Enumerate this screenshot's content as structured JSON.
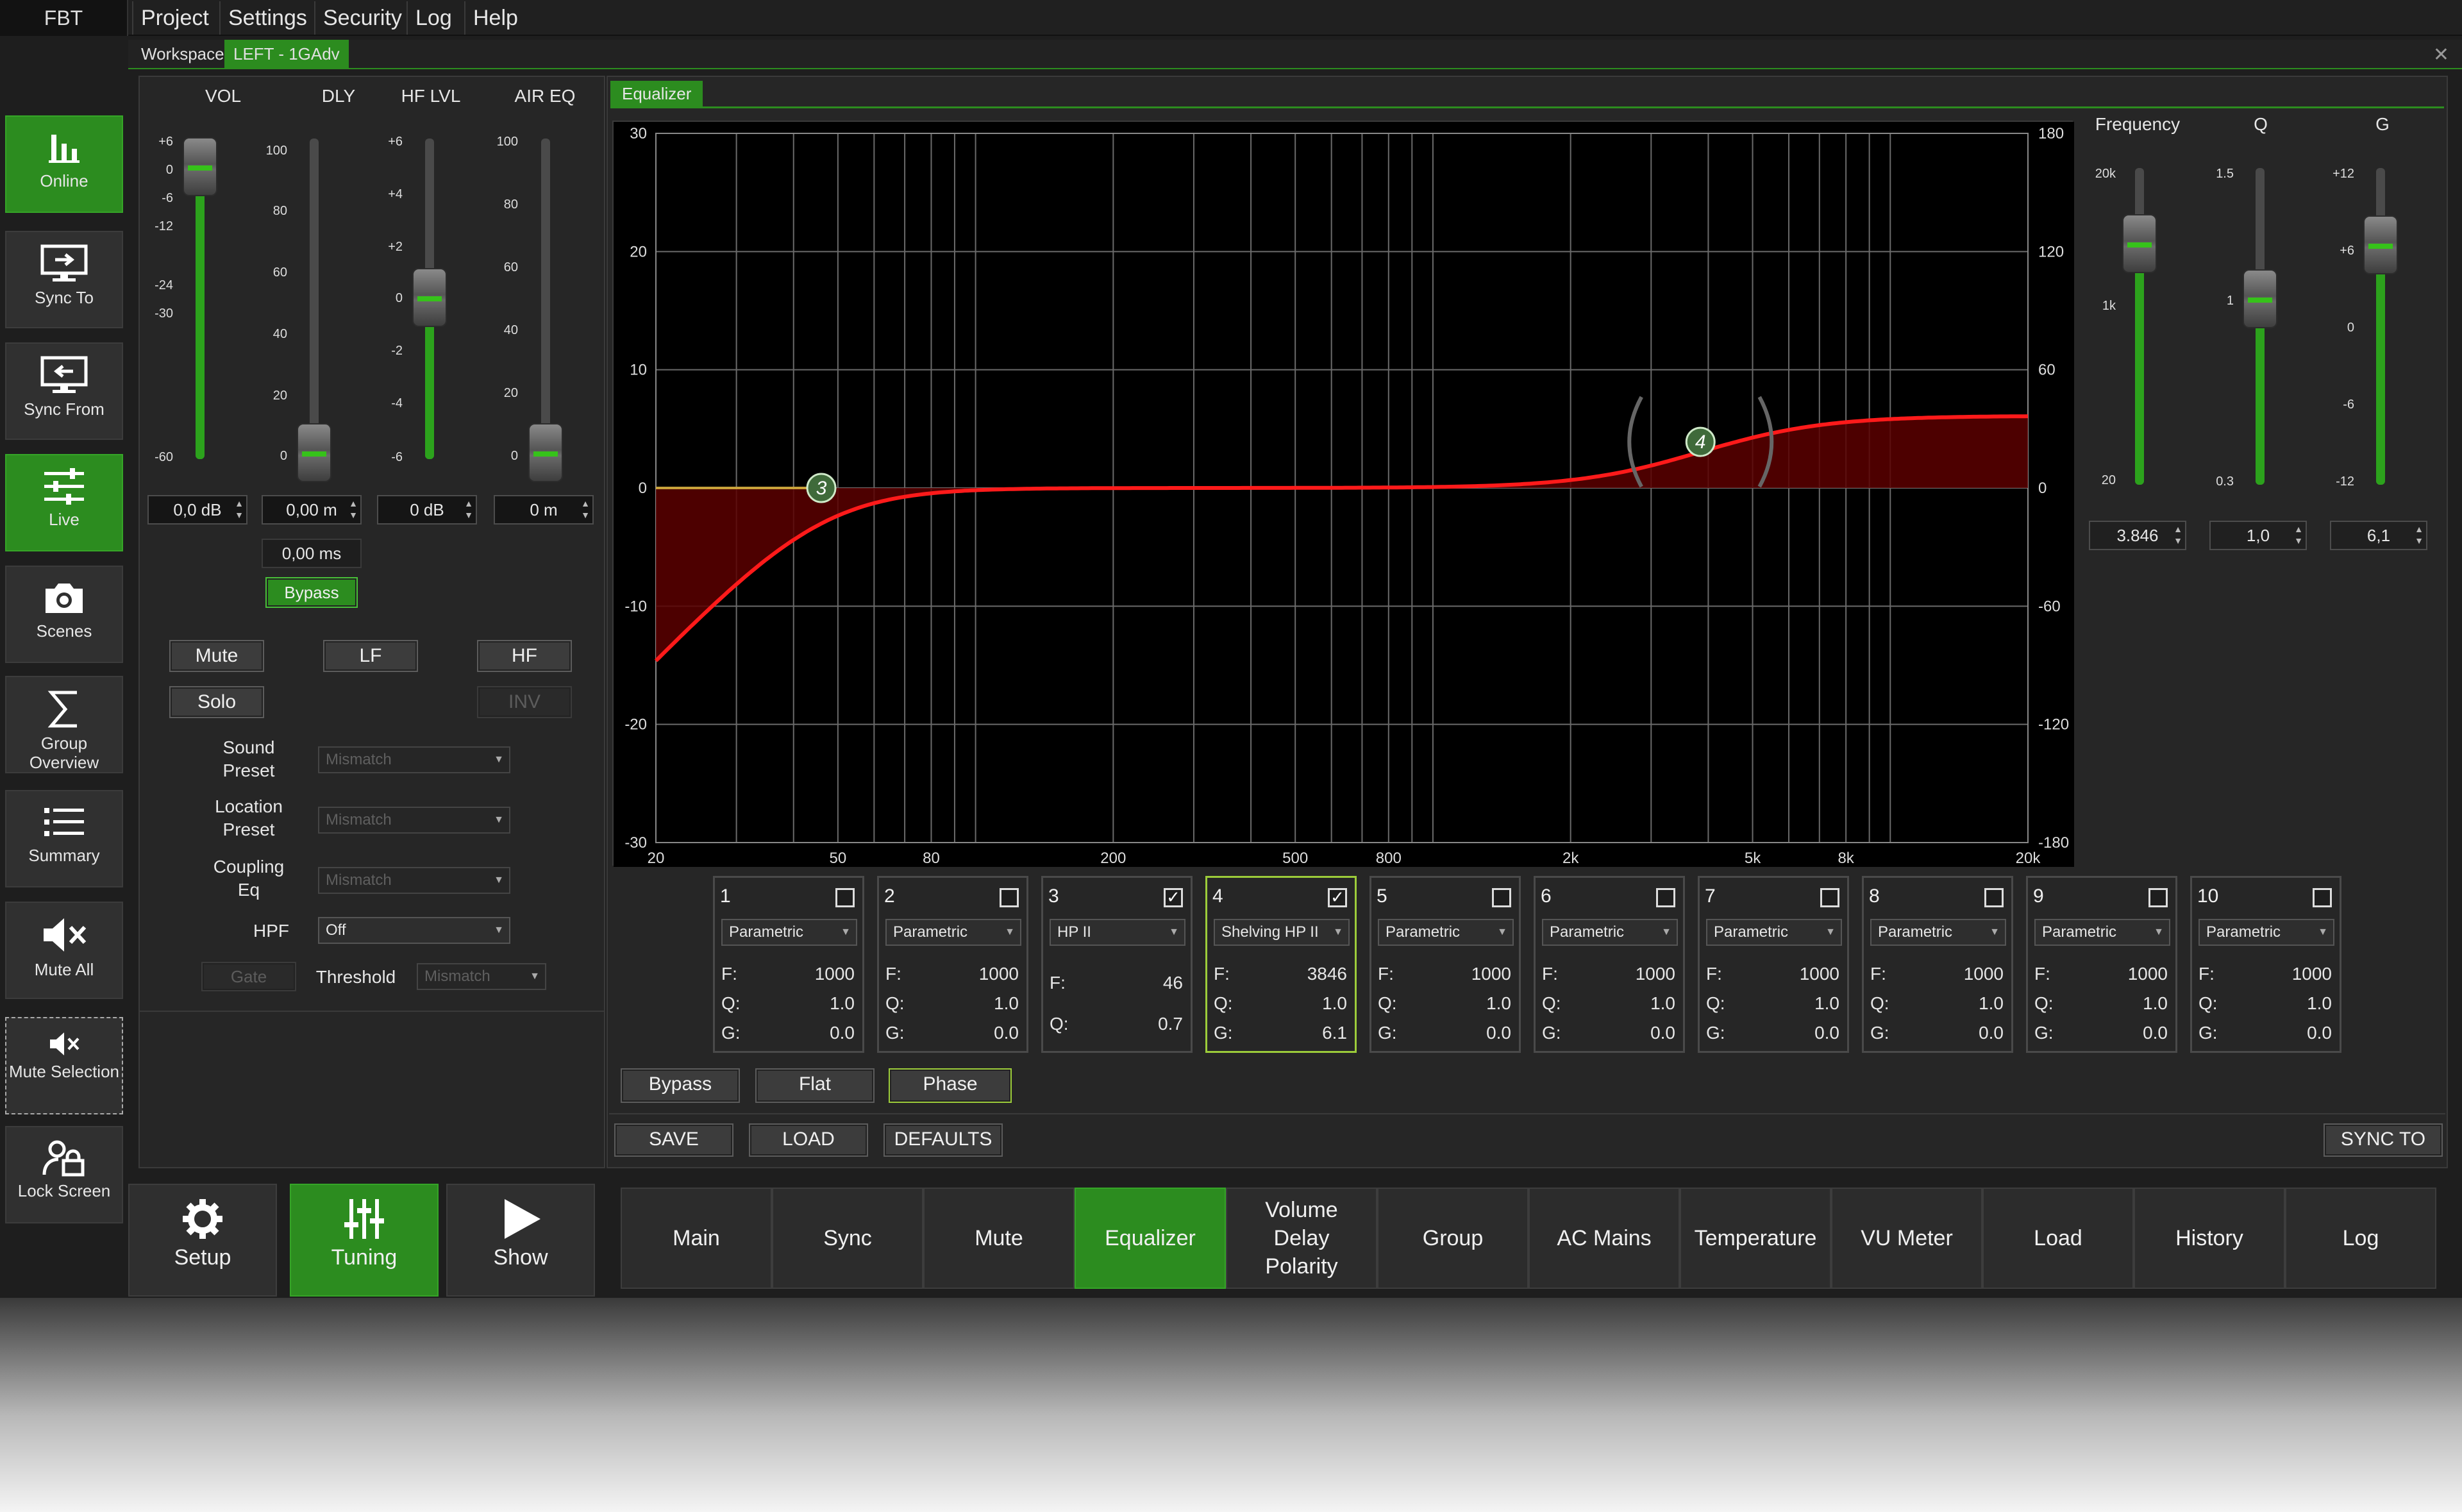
{
  "menu": {
    "brand": "FBT",
    "items": [
      "Project",
      "Settings",
      "Security",
      "Log",
      "Help"
    ]
  },
  "workspace_tabs": {
    "workspace": "Workspace",
    "device": "LEFT - 1GAdv"
  },
  "nav": [
    {
      "label": "Online",
      "icon": "bars-chart-icon",
      "active": true
    },
    {
      "label": "Sync To",
      "icon": "monitor-sync-to-icon",
      "active": false
    },
    {
      "label": "Sync From",
      "icon": "monitor-sync-from-icon",
      "active": false
    },
    {
      "label": "Live",
      "icon": "sliders-icon",
      "active": true
    },
    {
      "label": "Scenes",
      "icon": "camera-icon",
      "active": false
    },
    {
      "label": "Group Overview",
      "icon": "sigma-icon",
      "active": false
    },
    {
      "label": "Summary",
      "icon": "list-icon",
      "active": false
    },
    {
      "label": "Mute All",
      "icon": "speaker-mute-icon",
      "active": false
    },
    {
      "label": "Mute Selection",
      "icon": "speaker-mute-small-icon",
      "active": false
    },
    {
      "label": "Lock Screen",
      "icon": "user-lock-icon",
      "active": false
    }
  ],
  "channel": {
    "headers": {
      "vol": "VOL",
      "dly": "DLY",
      "hflvl": "HF LVL",
      "aireq": "AIR EQ"
    },
    "vol_ticks": [
      "+6",
      "0",
      "-6",
      "-12",
      "-24",
      "-30",
      "-60"
    ],
    "dly_ticks": [
      "100",
      "80",
      "60",
      "40",
      "20",
      "0"
    ],
    "hf_ticks": [
      "+6",
      "+4",
      "+2",
      "0",
      "-2",
      "-4",
      "-6"
    ],
    "air_ticks": [
      "100",
      "80",
      "60",
      "40",
      "20",
      "0"
    ],
    "vol_value": "0,0 dB",
    "dly_value": "0,00 m",
    "hf_value": "0 dB",
    "air_value": "0 m",
    "dly_ms": "0,00 ms",
    "bypass": "Bypass",
    "mute": "Mute",
    "lf": "LF",
    "hf": "HF",
    "solo": "Solo",
    "inv": "INV",
    "sound_preset_label": "Sound Preset",
    "sound_preset_value": "Mismatch",
    "location_preset_label": "Location Preset",
    "location_preset_value": "Mismatch",
    "coupling_eq_label": "Coupling Eq",
    "coupling_eq_value": "Mismatch",
    "hpf_label": "HPF",
    "hpf_value": "Off",
    "gate": "Gate",
    "threshold_label": "Threshold",
    "threshold_value": "Mismatch"
  },
  "eq": {
    "tab": "Equalizer",
    "y_left": [
      "30",
      "20",
      "10",
      "0",
      "-10",
      "-20",
      "-30"
    ],
    "y_right": [
      "180",
      "120",
      "60",
      "0",
      "-60",
      "-120",
      "-180"
    ],
    "x_labels": [
      "20",
      "50",
      "80",
      "200",
      "500",
      "800",
      "2k",
      "5k",
      "8k",
      "20k"
    ],
    "markers": [
      "3",
      "4"
    ],
    "right_panel": {
      "frequency": "Frequency",
      "q": "Q",
      "g": "G",
      "f_ticks": [
        "20k",
        "1k",
        "20"
      ],
      "q_ticks": [
        "1.5",
        "1",
        "0.3"
      ],
      "g_ticks": [
        "+12",
        "+6",
        "0",
        "-6",
        "-12"
      ],
      "f_value": "3.846",
      "q_value": "1,0",
      "g_value": "6,1"
    },
    "bands": [
      {
        "n": "1",
        "type": "Parametric",
        "f": "1000",
        "q": "1.0",
        "g": "0.0",
        "checked": false
      },
      {
        "n": "2",
        "type": "Parametric",
        "f": "1000",
        "q": "1.0",
        "g": "0.0",
        "checked": false
      },
      {
        "n": "3",
        "type": "HP II",
        "f": "46",
        "q": "0.7",
        "g": "",
        "checked": true
      },
      {
        "n": "4",
        "type": "Shelving HP II",
        "f": "3846",
        "q": "1.0",
        "g": "6.1",
        "checked": true
      },
      {
        "n": "5",
        "type": "Parametric",
        "f": "1000",
        "q": "1.0",
        "g": "0.0",
        "checked": false
      },
      {
        "n": "6",
        "type": "Parametric",
        "f": "1000",
        "q": "1.0",
        "g": "0.0",
        "checked": false
      },
      {
        "n": "7",
        "type": "Parametric",
        "f": "1000",
        "q": "1.0",
        "g": "0.0",
        "checked": false
      },
      {
        "n": "8",
        "type": "Parametric",
        "f": "1000",
        "q": "1.0",
        "g": "0.0",
        "checked": false
      },
      {
        "n": "9",
        "type": "Parametric",
        "f": "1000",
        "q": "1.0",
        "g": "0.0",
        "checked": false
      },
      {
        "n": "10",
        "type": "Parametric",
        "f": "1000",
        "q": "1.0",
        "g": "0.0",
        "checked": false
      }
    ],
    "row_labels": {
      "f": "F:",
      "q": "Q:",
      "g": "G:"
    },
    "bypass": "Bypass",
    "flat": "Flat",
    "phase": "Phase",
    "save": "SAVE",
    "load": "LOAD",
    "defaults": "DEFAULTS",
    "sync_to": "SYNC TO"
  },
  "bottom": {
    "modes": [
      {
        "label": "Setup",
        "icon": "gear-icon"
      },
      {
        "label": "Tuning",
        "icon": "tuning-sliders-icon",
        "active": true
      },
      {
        "label": "Show",
        "icon": "play-icon"
      }
    ],
    "tabs": [
      "Main",
      "Sync",
      "Mute",
      "Equalizer",
      "Volume Delay Polarity",
      "Group",
      "AC Mains",
      "Temperature",
      "VU Meter",
      "Load",
      "History",
      "Log"
    ],
    "active_tab": "Equalizer"
  }
}
